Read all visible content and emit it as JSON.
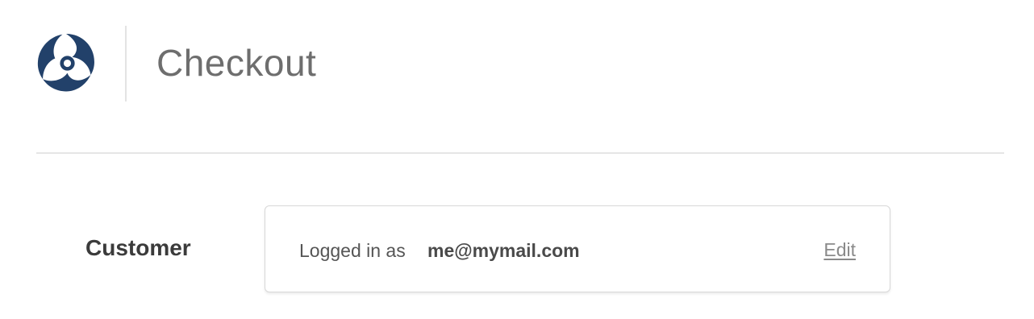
{
  "header": {
    "logo_icon": "brand-swirl-logo",
    "brand_color": "#22416a",
    "title": "Checkout"
  },
  "customer_section": {
    "label": "Customer",
    "logged_in_prefix": "Logged in as",
    "email": "me@mymail.com",
    "edit_label": "Edit"
  }
}
